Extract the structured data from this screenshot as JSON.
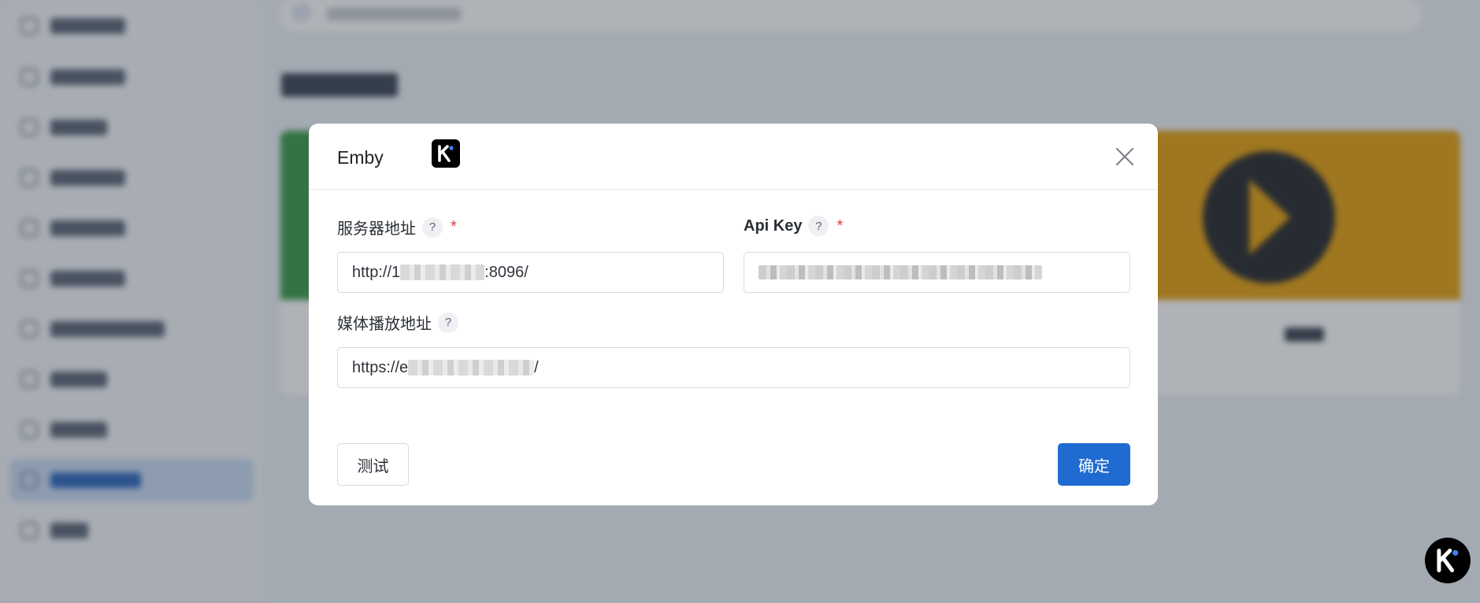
{
  "dialog": {
    "title": "Emby",
    "server_address": {
      "label": "服务器地址",
      "help": "?",
      "required": "*",
      "value_prefix": "http://1",
      "value_suffix": ":8096/"
    },
    "api_key": {
      "label": "Api Key",
      "help": "?",
      "required": "*"
    },
    "media_url": {
      "label": "媒体播放地址",
      "help": "?",
      "value_prefix": "https://e",
      "value_suffix": "/"
    },
    "test_button": "测试",
    "confirm_button": "确定"
  },
  "icons": {
    "close": "close-icon",
    "brand_logo": "k-logo-icon",
    "help": "question-icon"
  },
  "colors": {
    "primary": "#1f6bd1",
    "required": "#e23b3b",
    "overlay": "rgba(44,52,64,0.38)",
    "plex": "#e5a00d",
    "card_green": "#3a9a4b"
  }
}
